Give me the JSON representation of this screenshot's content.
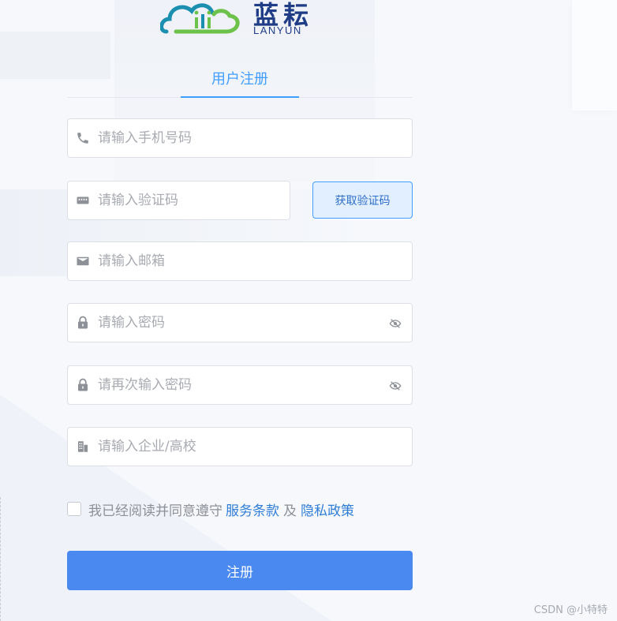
{
  "brand": {
    "name": "蓝耘",
    "sub": "LANYUN",
    "colors": {
      "primary": "#1f3c86",
      "teal": "#1b8fb0",
      "green": "#6cc24a"
    }
  },
  "tabs": [
    {
      "label": "用户注册",
      "active": true
    }
  ],
  "form": {
    "phone": {
      "placeholder": "请输入手机号码",
      "icon": "phone-icon"
    },
    "code": {
      "placeholder": "请输入验证码",
      "icon": "keyboard-icon",
      "button_label": "获取验证码"
    },
    "email": {
      "placeholder": "请输入邮箱",
      "icon": "mail-icon"
    },
    "password": {
      "placeholder": "请输入密码",
      "icon": "lock-icon",
      "toggle_icon": "eye-off-icon"
    },
    "password_confirm": {
      "placeholder": "请再次输入密码",
      "icon": "lock-icon",
      "toggle_icon": "eye-off-icon"
    },
    "company": {
      "placeholder": "请输入企业/高校",
      "icon": "building-icon"
    }
  },
  "agreement": {
    "checked": false,
    "prefix": "我已经阅读并同意遵守",
    "terms_link": "服务条款",
    "and": "及",
    "privacy_link": "隐私政策"
  },
  "submit": {
    "label": "注册"
  },
  "accent": "#409eff",
  "watermark": "CSDN @小特特"
}
